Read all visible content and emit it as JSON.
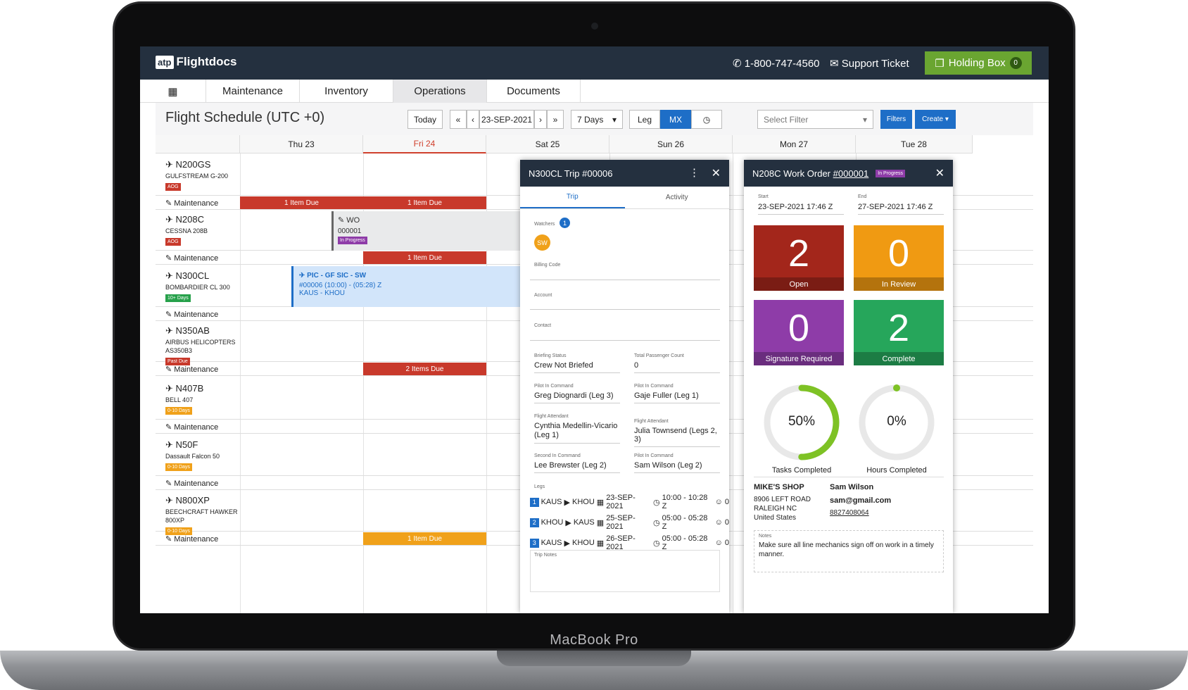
{
  "device_label": "MacBook Pro",
  "header": {
    "logo_prefix": "atp",
    "logo_name": "Flightdocs",
    "phone": "1-800-747-4560",
    "support": "Support Ticket",
    "holding_box": "Holding Box",
    "holding_count": "0"
  },
  "nav": {
    "items": [
      "Maintenance",
      "Inventory",
      "Operations",
      "Documents"
    ],
    "active": "Operations"
  },
  "toolbar": {
    "title": "Flight Schedule (UTC +0)",
    "today": "Today",
    "date": "23-SEP-2021",
    "range": "7 Days",
    "leg": "Leg",
    "mx": "MX",
    "filter_placeholder": "Select Filter",
    "filters": "Filters",
    "create": "Create"
  },
  "days": [
    "Thu 23",
    "Fri 24",
    "Sat 25",
    "Sun 26",
    "Mon 27",
    "Tue 28"
  ],
  "aircraft": [
    {
      "tail": "N200GS",
      "model": "GULFSTREAM G-200",
      "badge": "AOG",
      "badge_color": "#c8392b"
    },
    {
      "tail": "N208C",
      "model": "CESSNA 208B",
      "badge": "AOG",
      "badge_color": "#c8392b"
    },
    {
      "tail": "N300CL",
      "model": "BOMBARDIER CL 300",
      "badge": "10+ Days",
      "badge_color": "#27a14b"
    },
    {
      "tail": "N350AB",
      "model": "AIRBUS HELICOPTERS AS350B3",
      "badge": "Past Due",
      "badge_color": "#c8392b"
    },
    {
      "tail": "N407B",
      "model": "BELL 407",
      "badge": "0-10 Days",
      "badge_color": "#f0a11a"
    },
    {
      "tail": "N50F",
      "model": "Dassault Falcon 50",
      "badge": "0-10 Days",
      "badge_color": "#f0a11a"
    },
    {
      "tail": "N800XP",
      "model": "BEECHCRAFT HAWKER 800XP",
      "badge": "0-10 Days",
      "badge_color": "#f0a11a"
    }
  ],
  "maintenance_label": "Maintenance",
  "bars": {
    "item_due": "1 Item Due",
    "items_due_2": "2 Items Due"
  },
  "wo_block": {
    "label": "WO",
    "number": "000001",
    "status": "In Progress"
  },
  "trip_block": {
    "crew": "PIC - GF  SIC - SW",
    "line2": "#00006 (10:00) - (05:28) Z",
    "route": "KAUS - KHOU"
  },
  "trip_panel": {
    "title": "N300CL Trip #00006",
    "tabs": [
      "Trip",
      "Activity"
    ],
    "watchers_label": "Watchers",
    "watchers_count": "1",
    "watcher_initials": "SW",
    "billing_label": "Billing Code",
    "account_label": "Account",
    "contact_label": "Contact",
    "briefing_label": "Briefing Status",
    "briefing_value": "Crew Not Briefed",
    "pax_label": "Total Passenger Count",
    "pax_value": "0",
    "pic1_label": "Pilot In Command",
    "pic1_value": "Greg Diognardi (Leg 3)",
    "pic2_label": "Pilot In Command",
    "pic2_value": "Gaje Fuller (Leg 1)",
    "fa1_label": "Flight Attendant",
    "fa1_value": "Cynthia Medellin-Vicario (Leg 1)",
    "fa2_label": "Flight Attendant",
    "fa2_value": "Julia Townsend (Legs 2, 3)",
    "sic_label": "Second In Command",
    "sic_value": "Lee Brewster (Leg 2)",
    "pic3_label": "Pilot In Command",
    "pic3_value": "Sam Wilson (Leg 2)",
    "legs_label": "Legs",
    "legs": [
      {
        "n": "1",
        "from": "KAUS",
        "to": "KHOU",
        "date": "23-SEP-2021",
        "time": "10:00 - 10:28 Z",
        "pax": "0"
      },
      {
        "n": "2",
        "from": "KHOU",
        "to": "KAUS",
        "date": "25-SEP-2021",
        "time": "05:00 - 05:28 Z",
        "pax": "0"
      },
      {
        "n": "3",
        "from": "KAUS",
        "to": "KHOU",
        "date": "26-SEP-2021",
        "time": "05:00 - 05:28 Z",
        "pax": "0"
      }
    ],
    "notes_label": "Trip Notes"
  },
  "wo_panel": {
    "title": "N208C Work Order ",
    "wo_num": "#000001",
    "status": "In Progress",
    "start_label": "Start",
    "start_value": "23-SEP-2021 17:46 Z",
    "end_label": "End",
    "end_value": "27-SEP-2021 17:46 Z",
    "tiles": [
      {
        "value": "2",
        "label": "Open",
        "color": "#a3261b"
      },
      {
        "value": "0",
        "label": "In Review",
        "color": "#f09a12"
      },
      {
        "value": "0",
        "label": "Signature Required",
        "color": "#8e3ca8"
      },
      {
        "value": "2",
        "label": "Complete",
        "color": "#26a65b"
      }
    ],
    "tasks_pct": "50%",
    "tasks_fraction": 0.5,
    "tasks_label": "Tasks Completed",
    "hours_pct": "0%",
    "hours_fraction": 0,
    "hours_label": "Hours Completed",
    "shop_name": "MIKE'S SHOP",
    "shop_addr1": "8906 LEFT ROAD",
    "shop_addr2": "RALEIGH NC",
    "shop_addr3": "United States",
    "contact_name": "Sam Wilson",
    "contact_email": "sam@gmail.com",
    "contact_phone": "8827408064",
    "notes_label": "Notes",
    "notes": "Make sure all line mechanics sign off on work in a timely manner."
  }
}
